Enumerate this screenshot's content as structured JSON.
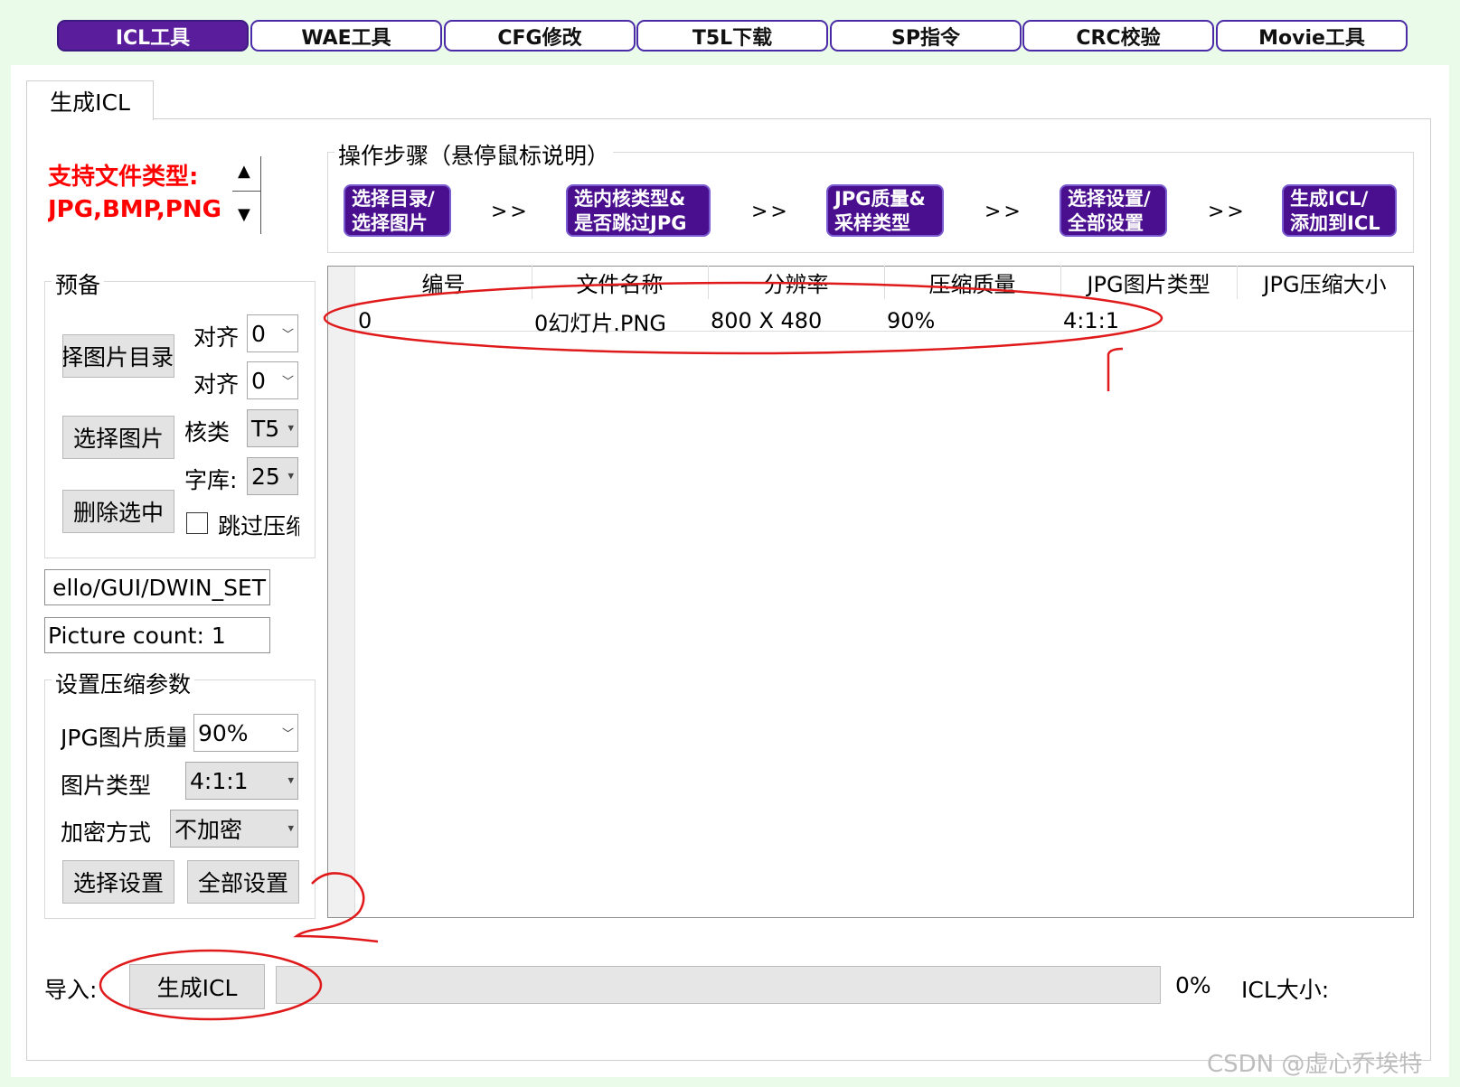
{
  "top_tabs": [
    {
      "label": "ICL工具",
      "active": true
    },
    {
      "label": "WAE工具",
      "active": false
    },
    {
      "label": "CFG修改",
      "active": false
    },
    {
      "label": "T5L下载",
      "active": false
    },
    {
      "label": "SP指令",
      "active": false
    },
    {
      "label": "CRC校验",
      "active": false
    },
    {
      "label": "Movie工具",
      "active": false
    }
  ],
  "page_tab": "生成ICL",
  "support": {
    "line1": "支持文件类型:",
    "line2": "JPG,BMP,PNG"
  },
  "prep": {
    "title": "预备",
    "select_dir_btn": "择图片目录",
    "select_pic_btn": "选择图片",
    "delete_btn": "删除选中",
    "h_align_label": "对齐",
    "h_align_value": "0",
    "v_align_label": "对齐",
    "v_align_value": "0",
    "core_label": "核类",
    "core_value": "T5",
    "font_label": "字库:",
    "font_value": "25",
    "skip_label": "跳过压缩"
  },
  "path_value": "ello/GUI/DWIN_SET",
  "picture_count": "Picture count: 1",
  "compress": {
    "title": "设置压缩参数",
    "quality_label": "JPG图片质量",
    "quality_value": "90%",
    "type_label": "图片类型",
    "type_value": "4:1:1",
    "encrypt_label": "加密方式",
    "encrypt_value": "不加密",
    "select_settings_btn": "选择设置",
    "all_settings_btn": "全部设置"
  },
  "steps": {
    "title": "操作步骤（悬停鼠标说明）",
    "items": [
      {
        "line1": "选择目录/",
        "line2": "选择图片"
      },
      {
        "line1": "选内核类型&",
        "line2": "是否跳过JPG"
      },
      {
        "line1": "JPG质量&",
        "line2": "采样类型"
      },
      {
        "line1": "选择设置/",
        "line2": "全部设置"
      },
      {
        "line1": "生成ICL/",
        "line2": "添加到ICL"
      }
    ],
    "separator": ">>"
  },
  "table": {
    "columns": [
      "编号",
      "文件名称",
      "分辨率",
      "压缩质量",
      "JPG图片类型",
      "JPG压缩大小"
    ],
    "rows": [
      {
        "id": "0",
        "name": "0幻灯片.PNG",
        "resolution": "800 X 480",
        "quality": "90%",
        "type": "4:1:1",
        "size": ""
      }
    ]
  },
  "bottom": {
    "import_label": "导入:",
    "generate_btn": "生成ICL",
    "progress_percent": "0%",
    "progress_value": 0,
    "icl_size_label": "ICL大小:"
  },
  "watermark": "CSDN @虚心乔埃特",
  "colors": {
    "accent": "#5a1d9c",
    "support_text": "#ff0000",
    "annotation": "#e0191b",
    "bg": "#eafbea"
  }
}
